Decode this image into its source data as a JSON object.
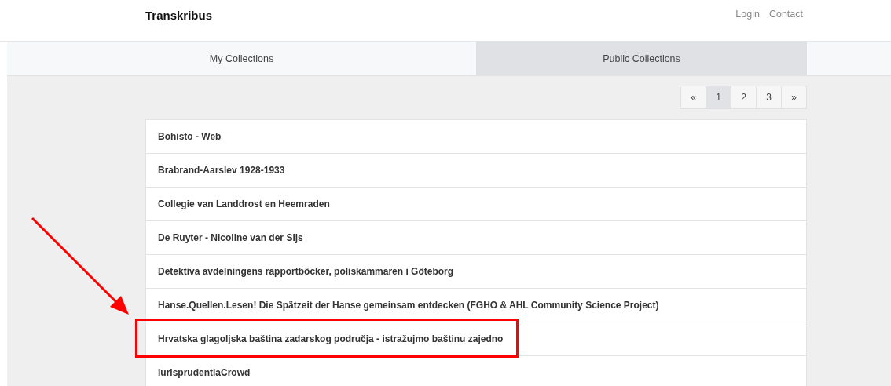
{
  "header": {
    "brand": "Transkribus",
    "links": [
      "Login",
      "Contact"
    ]
  },
  "tabs": [
    {
      "label": "My Collections",
      "selected": false
    },
    {
      "label": "Public Collections",
      "selected": true
    }
  ],
  "pagination": [
    {
      "label": "«",
      "selected": false
    },
    {
      "label": "1",
      "selected": true
    },
    {
      "label": "2",
      "selected": false
    },
    {
      "label": "3",
      "selected": false
    },
    {
      "label": "»",
      "selected": false
    }
  ],
  "collections": [
    {
      "name": "Bohisto - Web",
      "highlighted": false
    },
    {
      "name": "Brabrand-Aarslev 1928-1933",
      "highlighted": false
    },
    {
      "name": "Collegie van Landdrost en Heemraden",
      "highlighted": false
    },
    {
      "name": "De Ruyter - Nicoline van der Sijs",
      "highlighted": false
    },
    {
      "name": "Detektiva avdelningens rapportböcker, poliskammaren i Göteborg",
      "highlighted": false
    },
    {
      "name": "Hanse.Quellen.Lesen! Die Spätzeit der Hanse gemeinsam entdecken (FGHO & AHL Community Science Project)",
      "highlighted": false
    },
    {
      "name": "Hrvatska glagoljska baština zadarskog područja - istražujmo baštinu zajedno",
      "highlighted": true
    },
    {
      "name": "IurisprudentiaCrowd",
      "highlighted": false
    }
  ]
}
